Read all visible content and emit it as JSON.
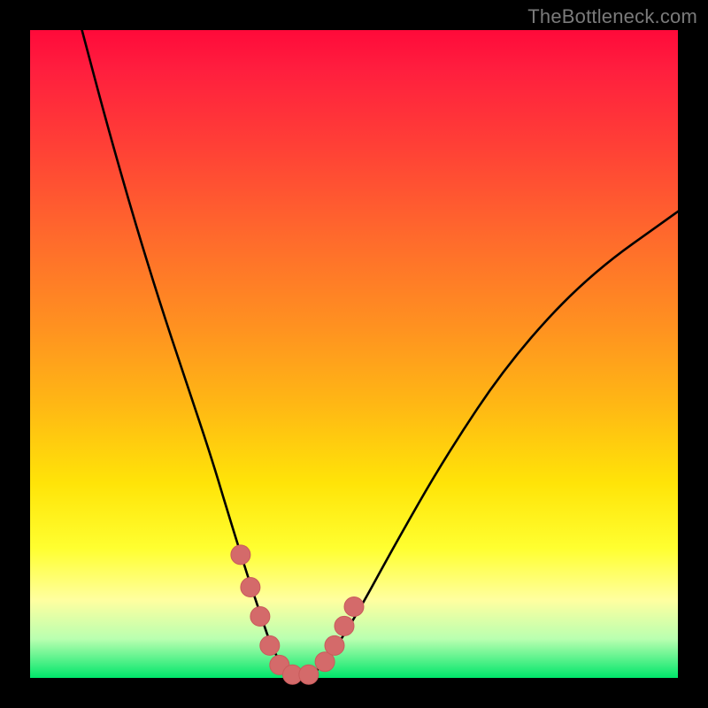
{
  "watermark": "TheBottleneck.com",
  "colors": {
    "frame": "#000000",
    "gradient_top": "#ff0a3a",
    "gradient_bottom": "#00e66a",
    "curve": "#000000",
    "marker_fill": "#d46a6a",
    "marker_stroke": "#c95b5b"
  },
  "chart_data": {
    "type": "line",
    "title": "",
    "xlabel": "",
    "ylabel": "",
    "xlim": [
      0,
      100
    ],
    "ylim": [
      0,
      100
    ],
    "grid": false,
    "legend": false,
    "series": [
      {
        "name": "curve",
        "x": [
          8,
          12,
          16,
          20,
          24,
          28,
          31,
          33.5,
          35.5,
          37,
          38.5,
          40,
          42,
          44,
          46,
          50,
          56,
          64,
          74,
          86,
          100
        ],
        "y": [
          100,
          85,
          71,
          58,
          46,
          34,
          24,
          16,
          10,
          5.5,
          2.5,
          0.8,
          0,
          0.8,
          3,
          9,
          20,
          34,
          49,
          62,
          72
        ]
      }
    ],
    "markers": [
      {
        "x": 32.5,
        "y": 19
      },
      {
        "x": 34.0,
        "y": 14
      },
      {
        "x": 35.5,
        "y": 9.5
      },
      {
        "x": 37.0,
        "y": 5
      },
      {
        "x": 38.5,
        "y": 2
      },
      {
        "x": 40.5,
        "y": 0.5
      },
      {
        "x": 43.0,
        "y": 0.5
      },
      {
        "x": 45.5,
        "y": 2.5
      },
      {
        "x": 47.0,
        "y": 5
      },
      {
        "x": 48.5,
        "y": 8
      },
      {
        "x": 50.0,
        "y": 11
      }
    ]
  }
}
